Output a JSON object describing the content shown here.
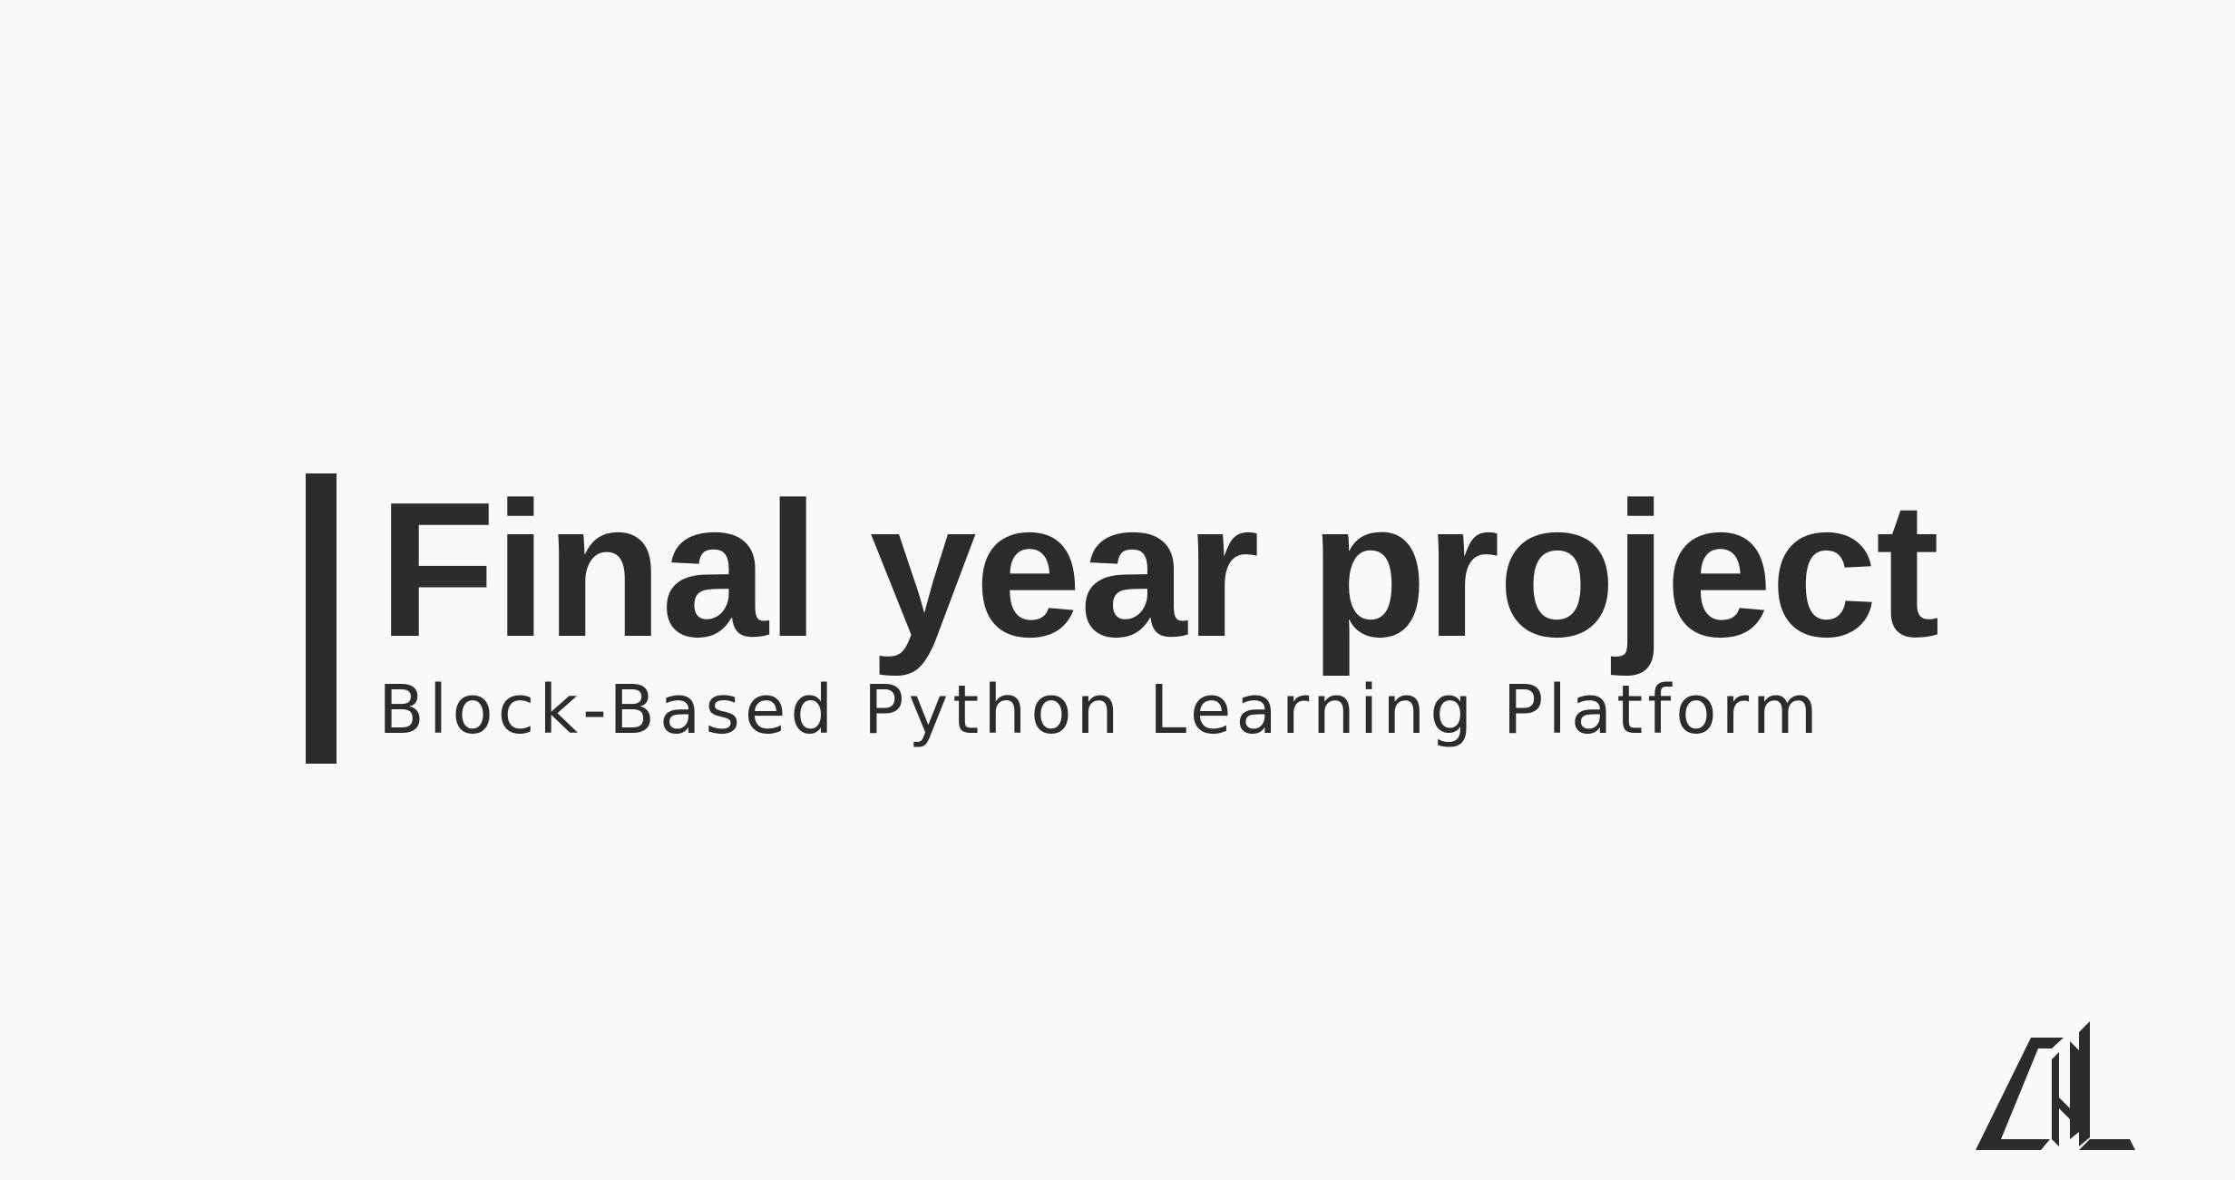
{
  "page": {
    "title": "Final year project",
    "subtitle": "Block-Based Python Learning Platform"
  },
  "logo": {
    "icon": "monogram-logo-icon"
  },
  "colors": {
    "background": "#f9f9f9",
    "foreground": "#2c2c2c"
  }
}
